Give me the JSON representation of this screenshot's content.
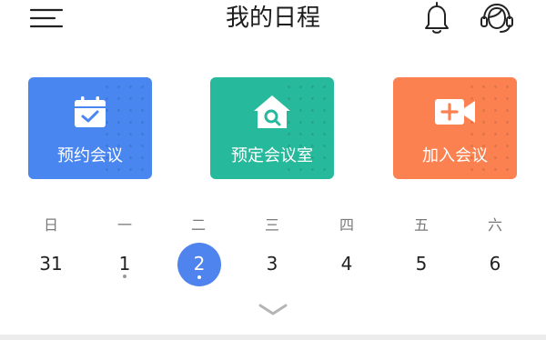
{
  "header": {
    "title": "我的日程",
    "icons": [
      "menu-icon",
      "bell-icon",
      "customer-service-icon"
    ]
  },
  "actions": [
    {
      "label": "预约会议",
      "icon": "calendar-check-icon",
      "color": "#4a86f0"
    },
    {
      "label": "预定会议室",
      "icon": "room-search-icon",
      "color": "#27b99b"
    },
    {
      "label": "加入会议",
      "icon": "video-plus-icon",
      "color": "#fb8150"
    }
  ],
  "calendar": {
    "weekdays": [
      "日",
      "一",
      "二",
      "三",
      "四",
      "五",
      "六"
    ],
    "dates": [
      {
        "day": "31",
        "selected": false,
        "has_event": false
      },
      {
        "day": "1",
        "selected": false,
        "has_event": true
      },
      {
        "day": "2",
        "selected": true,
        "has_event": true
      },
      {
        "day": "3",
        "selected": false,
        "has_event": false
      },
      {
        "day": "4",
        "selected": false,
        "has_event": false
      },
      {
        "day": "5",
        "selected": false,
        "has_event": false
      },
      {
        "day": "6",
        "selected": false,
        "has_event": false
      }
    ],
    "selected_color": "#4f84ee",
    "expand_icon": "chevron-down-icon"
  }
}
